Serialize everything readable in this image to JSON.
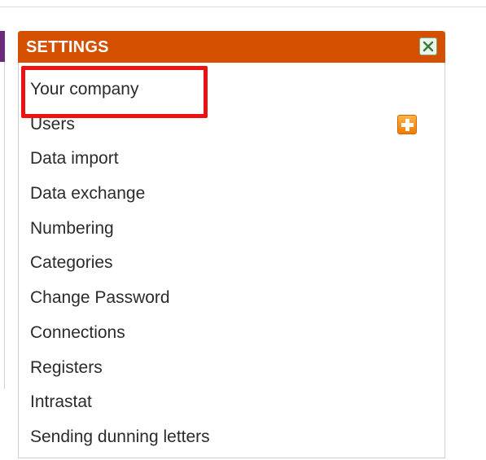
{
  "settings": {
    "title": "SETTINGS",
    "close_icon": "close-icon",
    "add_icon": "plus-icon",
    "items": [
      {
        "label": "Your company"
      },
      {
        "label": "Users"
      },
      {
        "label": "Data import"
      },
      {
        "label": "Data exchange"
      },
      {
        "label": "Numbering"
      },
      {
        "label": "Categories"
      },
      {
        "label": "Change Password"
      },
      {
        "label": "Connections"
      },
      {
        "label": "Registers"
      },
      {
        "label": "Intrastat"
      },
      {
        "label": "Sending dunning letters"
      }
    ]
  },
  "colors": {
    "header": "#d54f00",
    "highlight": "#ee1111",
    "add_button": "#f07c00",
    "left_accent": "#6a2c7a"
  }
}
